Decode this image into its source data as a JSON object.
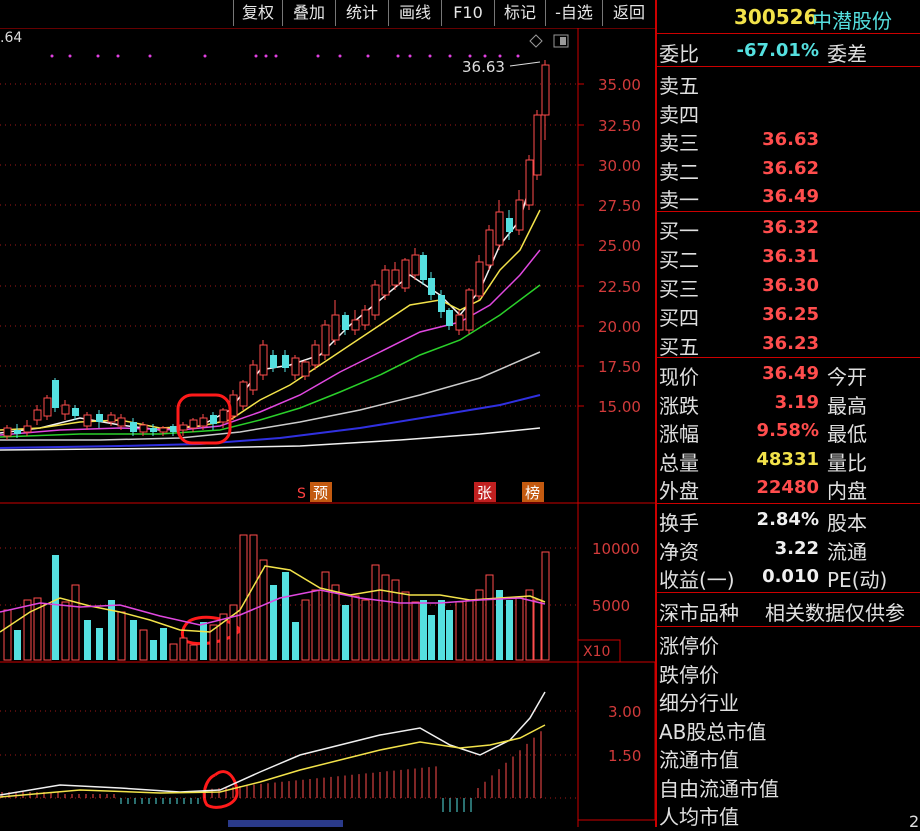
{
  "toolbar": {
    "buttons": [
      "复权",
      "叠加",
      "统计",
      "画线",
      "F10",
      "标记",
      "-自选",
      "返回"
    ]
  },
  "chart_top_left_price": ".64",
  "chart": {
    "last_price_label": "36.63",
    "price_axis": [
      "35.00",
      "32.50",
      "30.00",
      "27.50",
      "25.00",
      "22.50",
      "20.00",
      "17.50",
      "15.00"
    ],
    "volume_axis": [
      "10000",
      "5000"
    ],
    "volume_multiplier": "X10",
    "macd_axis": [
      "3.00",
      "1.50"
    ],
    "markers": [
      "预",
      "张",
      "榜"
    ],
    "marker_s": "S"
  },
  "quote": {
    "code": "300526",
    "name": "中潜股份",
    "weibi_label": "委比",
    "weibi_value": "-67.01%",
    "weicha_label": "委差",
    "asks": [
      {
        "label": "卖五",
        "price": ""
      },
      {
        "label": "卖四",
        "price": ""
      },
      {
        "label": "卖三",
        "price": "36.63"
      },
      {
        "label": "卖二",
        "price": "36.62"
      },
      {
        "label": "卖一",
        "price": "36.49"
      }
    ],
    "bids": [
      {
        "label": "买一",
        "price": "36.32"
      },
      {
        "label": "买二",
        "price": "36.31"
      },
      {
        "label": "买三",
        "price": "36.30"
      },
      {
        "label": "买四",
        "price": "36.25"
      },
      {
        "label": "买五",
        "price": "36.23"
      }
    ],
    "stats": [
      {
        "label": "现价",
        "value": "36.49",
        "label2": "今开",
        "color": "red"
      },
      {
        "label": "涨跌",
        "value": "3.19",
        "label2": "最高",
        "color": "red"
      },
      {
        "label": "涨幅",
        "value": "9.58%",
        "label2": "最低",
        "color": "red"
      },
      {
        "label": "总量",
        "value": "48331",
        "label2": "量比",
        "color": "yellow"
      },
      {
        "label": "外盘",
        "value": "22480",
        "label2": "内盘",
        "color": "red"
      }
    ],
    "stats2": [
      {
        "label": "换手",
        "value": "2.84%",
        "label2": "股本"
      },
      {
        "label": "净资",
        "value": "3.22",
        "label2": "流通"
      },
      {
        "label": "收益(一)",
        "value": "0.010",
        "label2": "PE(动)"
      }
    ],
    "market_tag": "深市品种",
    "market_note": "相关数据仅供参",
    "extra_rows": [
      "涨停价",
      "跌停价",
      "细分行业",
      "AB股总市值",
      "流通市值",
      "自由流通市值",
      "人均市值"
    ],
    "extra_tail": "2"
  }
}
